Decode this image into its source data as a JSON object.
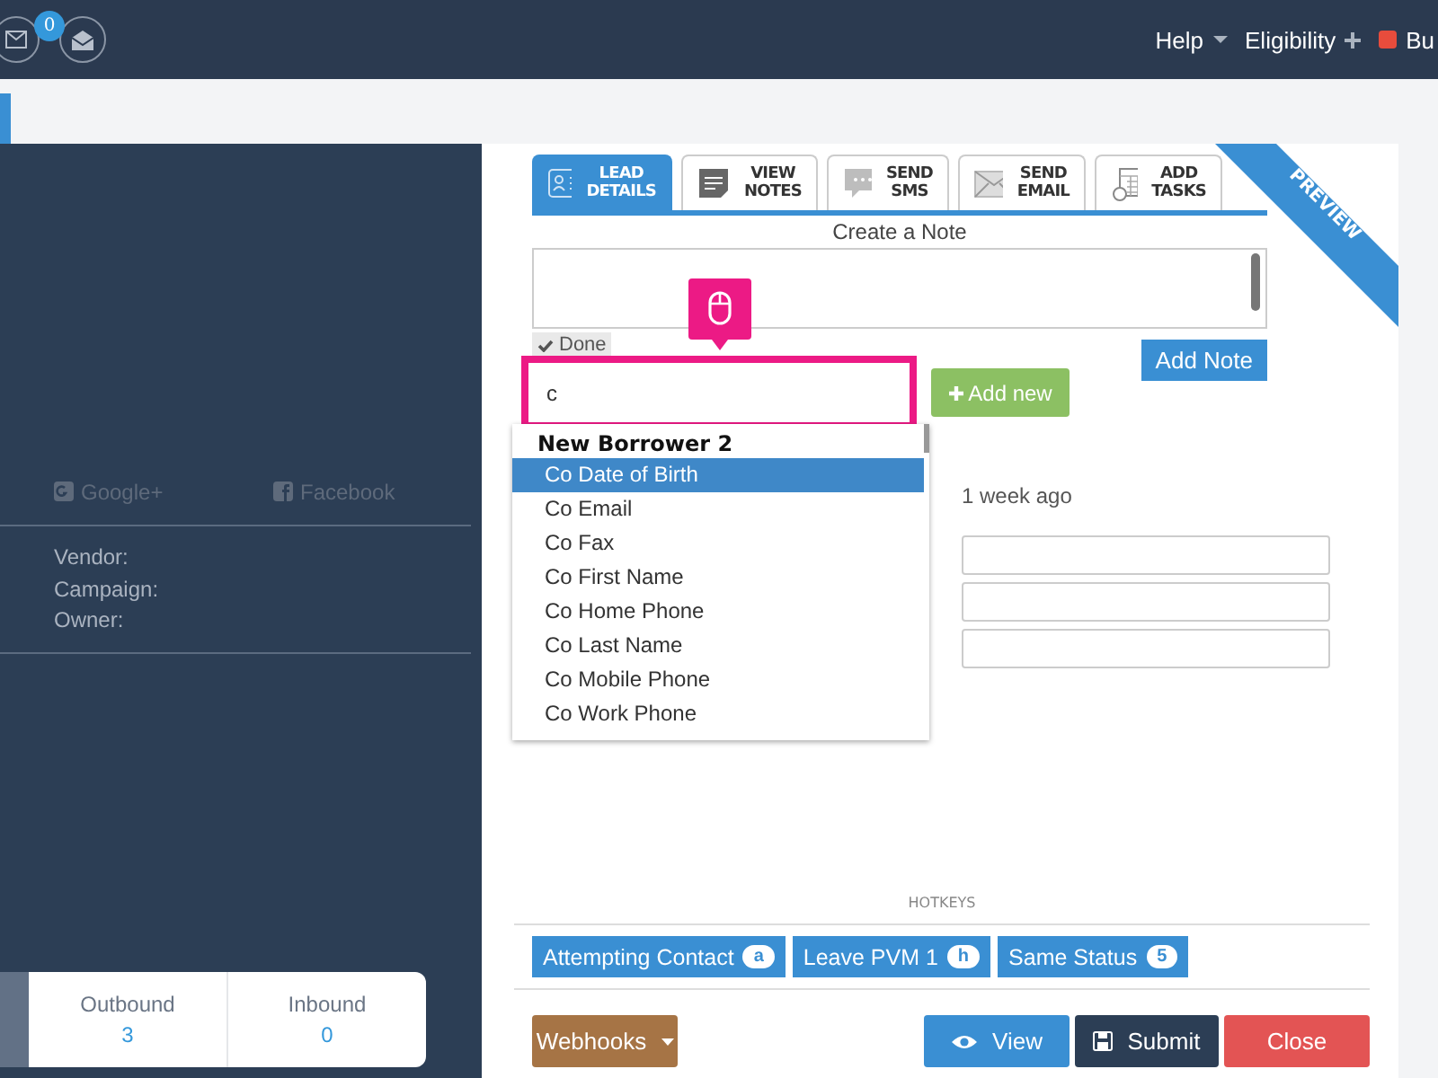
{
  "topbar": {
    "mail_badge": "0",
    "menu": [
      {
        "label": "Help",
        "kind": "dropdown"
      },
      {
        "label": "Eligibility",
        "kind": "plus"
      },
      {
        "label": "Bu",
        "kind": "flag"
      }
    ]
  },
  "lead": {
    "social": [
      {
        "label": "Google+",
        "kind": "google"
      },
      {
        "label": "Facebook",
        "kind": "facebook"
      }
    ],
    "fields": [
      "Vendor:",
      "Campaign:",
      "Owner:"
    ],
    "counts": [
      {
        "label": "Outbound",
        "value": "3"
      },
      {
        "label": "Inbound",
        "value": "0"
      }
    ]
  },
  "tabs": [
    {
      "lines": [
        "LEAD",
        "DETAILS"
      ],
      "kind": "card",
      "selected": true
    },
    {
      "lines": [
        "VIEW",
        "NOTES"
      ],
      "kind": "notes",
      "selected": false
    },
    {
      "lines": [
        "SEND",
        "SMS"
      ],
      "kind": "sms",
      "selected": false
    },
    {
      "lines": [
        "SEND",
        "EMAIL"
      ],
      "kind": "email",
      "selected": false
    },
    {
      "lines": [
        "ADD",
        "TASKS"
      ],
      "kind": "calendar",
      "selected": false
    }
  ],
  "ribbon": "PREVIEW",
  "note": {
    "title": "Create a Note",
    "done": "Done",
    "add": "Add Note"
  },
  "search": {
    "value": "c",
    "add": "Add new",
    "group": "New Borrower 2",
    "options": [
      {
        "label": "Co Date of Birth",
        "selected": true
      },
      {
        "label": "Co Email",
        "selected": false
      },
      {
        "label": "Co Fax",
        "selected": false
      },
      {
        "label": "Co First Name",
        "selected": false
      },
      {
        "label": "Co Home Phone",
        "selected": false
      },
      {
        "label": "Co Last Name",
        "selected": false
      },
      {
        "label": "Co Mobile Phone",
        "selected": false
      },
      {
        "label": "Co Work Phone",
        "selected": false
      }
    ]
  },
  "time": "1 week ago",
  "hotkeys": {
    "title": "HOTKEYS",
    "items": [
      {
        "label": "Attempting Contact",
        "key": "a"
      },
      {
        "label": "Leave PVM 1",
        "key": "h"
      },
      {
        "label": "Same Status",
        "key": "5"
      }
    ]
  },
  "actions": [
    {
      "label": "Webhooks",
      "kind": "dropdown"
    },
    {
      "label": "View",
      "kind": "view"
    },
    {
      "label": "Submit",
      "kind": "submit"
    },
    {
      "label": "Close",
      "kind": "close"
    }
  ]
}
